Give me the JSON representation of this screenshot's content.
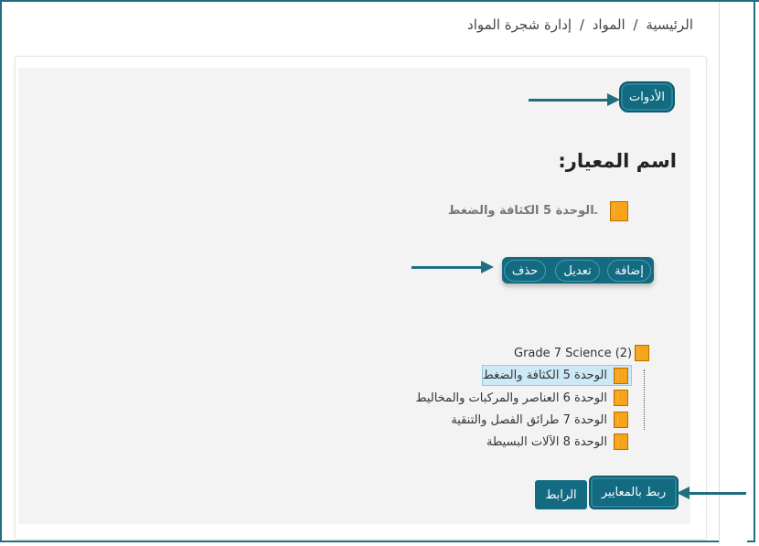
{
  "breadcrumb": {
    "home": "الرئيسية",
    "sep1": "/",
    "materials": "المواد",
    "sep2": "/",
    "current": "إدارة شجرة المواد"
  },
  "tools_button": "الأدوات",
  "standard_title": "اسم المعيار:",
  "selected_node": {
    "dash": "-",
    "label": "الوحدة 5 الكثافة والضغط",
    "icon": "book-icon"
  },
  "actions": {
    "add": "إضافة",
    "edit": "تعديل",
    "delete": "حذف"
  },
  "tree": {
    "root": "Grade 7 Science (2)",
    "items": [
      {
        "label": "الوحدة 5 الكثافة والضغط",
        "selected": true
      },
      {
        "label": "الوحدة 6 العناصر والمركبات والمخاليط",
        "selected": false
      },
      {
        "label": "الوحدة 7 طرائق الفصل والتنقية",
        "selected": false
      },
      {
        "label": "الوحدة 8 الآلات البسيطة",
        "selected": false
      }
    ]
  },
  "footer": {
    "link_button": "الرابط",
    "map_button": "ربط بالمعايير"
  },
  "colors": {
    "primary": "#136b82",
    "arrow": "#1f6f80",
    "book": "#f6a51a",
    "selection": "#cde8f6"
  }
}
